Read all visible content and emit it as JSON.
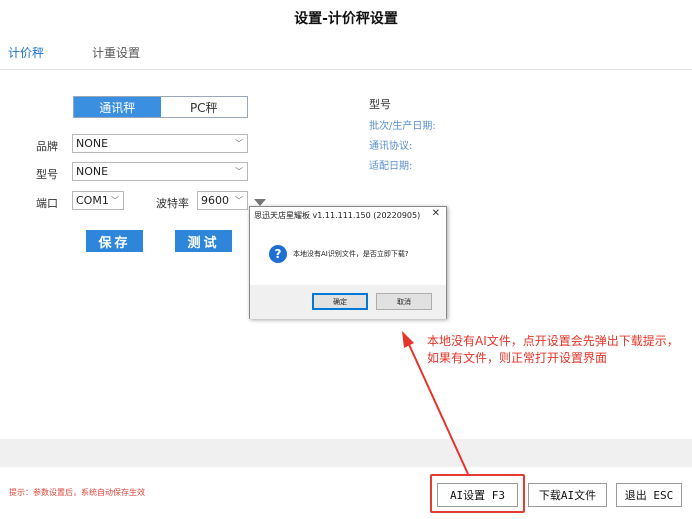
{
  "page": {
    "title": "设置-计价秤设置"
  },
  "tabs": [
    {
      "label": "计价秤",
      "active": true
    },
    {
      "label": "计重设置",
      "active": false
    }
  ],
  "segment": {
    "left": "通讯秤",
    "right": "PC秤",
    "selected": "通讯秤"
  },
  "form": {
    "brand_label": "品牌",
    "brand_value": "NONE",
    "model_label": "型号",
    "model_value": "NONE",
    "port_label": "端口",
    "port_value": "COM1",
    "baud_label": "波特率",
    "baud_value": "9600"
  },
  "actions": {
    "save": "保存",
    "test": "测试"
  },
  "info": {
    "model": "型号",
    "batch": "批次/生产日期:",
    "protocol": "通讯协议:",
    "adapt_date": "适配日期:"
  },
  "dialog": {
    "title": "思迅天店星耀板 v1.11.111.150  (20220905)",
    "close": "✕",
    "message": "本地没有AI识别文件，是否立即下载?",
    "ok": "确定",
    "cancel": "取消"
  },
  "annotation": {
    "text": "本地没有AI文件，点开设置会先弹出下载提示，如果有文件，则正常打开设置界面"
  },
  "footer": {
    "hint": "提示：参数设置后，系统自动保存生效",
    "ai_button": "AI设置 F3",
    "download_button": "下载AI文件",
    "exit_button": "退出 ESC"
  },
  "colors": {
    "accent": "#2d86d9",
    "annotation": "#e5342a"
  }
}
